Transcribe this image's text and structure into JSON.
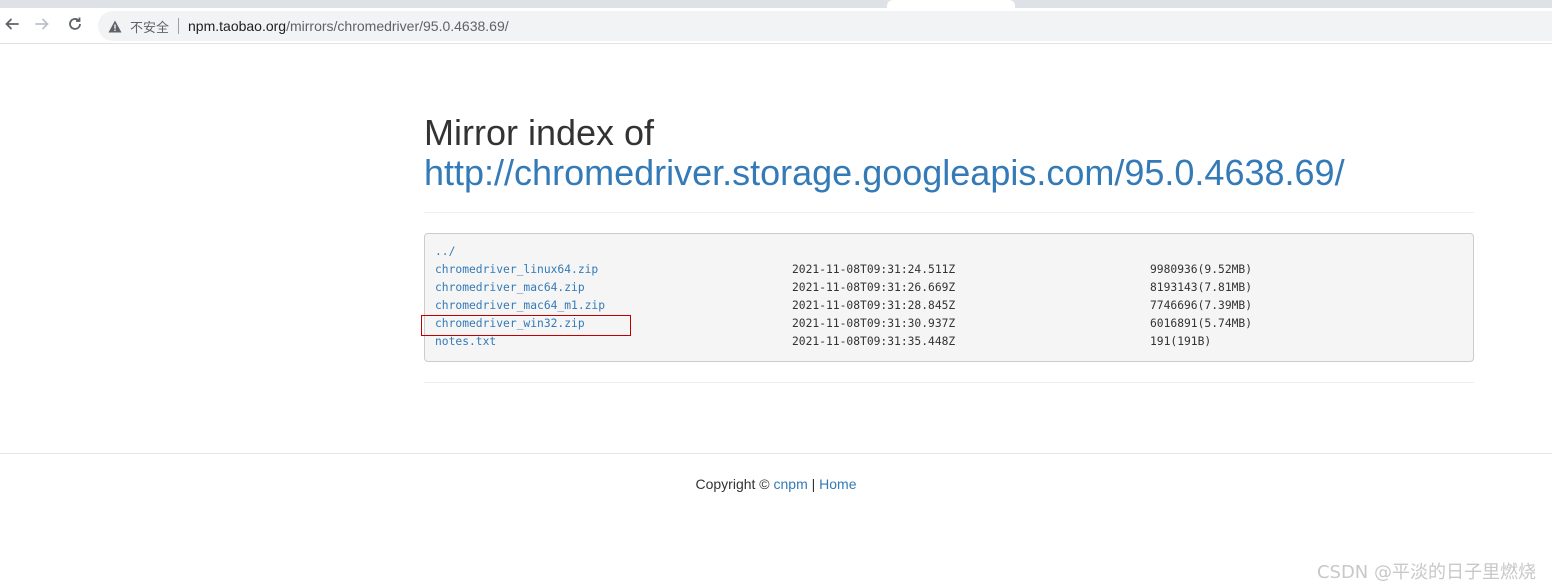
{
  "browser": {
    "not_secure_label": "不安全",
    "url_host": "npm.taobao.org",
    "url_path": "/mirrors/chromedriver/95.0.4638.69/"
  },
  "page": {
    "title_prefix": "Mirror index of",
    "title_link": "http://chromedriver.storage.googleapis.com/95.0.4638.69/",
    "parent_link": "../",
    "files": [
      {
        "name": "chromedriver_linux64.zip",
        "date": "2021-11-08T09:31:24.511Z",
        "size": "9980936(9.52MB)"
      },
      {
        "name": "chromedriver_mac64.zip",
        "date": "2021-11-08T09:31:26.669Z",
        "size": "8193143(7.81MB)"
      },
      {
        "name": "chromedriver_mac64_m1.zip",
        "date": "2021-11-08T09:31:28.845Z",
        "size": "7746696(7.39MB)"
      },
      {
        "name": "chromedriver_win32.zip",
        "date": "2021-11-08T09:31:30.937Z",
        "size": "6016891(5.74MB)"
      },
      {
        "name": "notes.txt",
        "date": "2021-11-08T09:31:35.448Z",
        "size": "191(191B)"
      }
    ]
  },
  "footer": {
    "copyright": "Copyright © ",
    "cnpm_link": "cnpm",
    "separator": " | ",
    "home_link": "Home"
  },
  "watermark": "CSDN @平淡的日子里燃烧",
  "icons": {
    "back": "arrow-left-icon",
    "forward": "arrow-right-icon",
    "reload": "reload-icon",
    "warning": "warning-triangle-icon"
  }
}
